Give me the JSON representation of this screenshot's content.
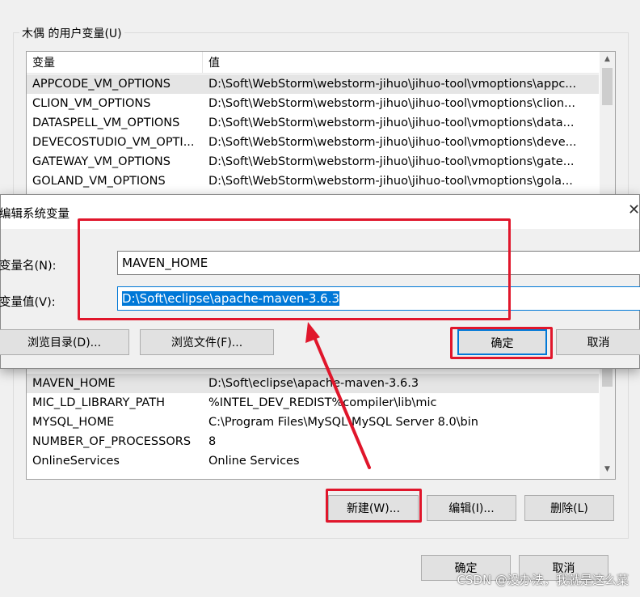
{
  "user_vars": {
    "group_title": "木偶 的用户变量(U)",
    "header": {
      "name": "变量",
      "value": "值"
    },
    "rows_top": [
      {
        "name": "APPCODE_VM_OPTIONS",
        "value": "D:\\Soft\\WebStorm\\webstorm-jihuo\\jihuo-tool\\vmoptions\\appc..."
      },
      {
        "name": "CLION_VM_OPTIONS",
        "value": "D:\\Soft\\WebStorm\\webstorm-jihuo\\jihuo-tool\\vmoptions\\clion..."
      },
      {
        "name": "DATASPELL_VM_OPTIONS",
        "value": "D:\\Soft\\WebStorm\\webstorm-jihuo\\jihuo-tool\\vmoptions\\data..."
      },
      {
        "name": "DEVECOSTUDIO_VM_OPTI...",
        "value": "D:\\Soft\\WebStorm\\webstorm-jihuo\\jihuo-tool\\vmoptions\\deve..."
      },
      {
        "name": "GATEWAY_VM_OPTIONS",
        "value": "D:\\Soft\\WebStorm\\webstorm-jihuo\\jihuo-tool\\vmoptions\\gate..."
      },
      {
        "name": "GOLAND_VM_OPTIONS",
        "value": "D:\\Soft\\WebStorm\\webstorm-jihuo\\jihuo-tool\\vmoptions\\gola..."
      }
    ],
    "rows_bottom": [
      {
        "name": "MAVEN_HOME",
        "value": "D:\\Soft\\eclipse\\apache-maven-3.6.3"
      },
      {
        "name": "MIC_LD_LIBRARY_PATH",
        "value": "%INTEL_DEV_REDIST%compiler\\lib\\mic"
      },
      {
        "name": "MYSQL_HOME",
        "value": "C:\\Program Files\\MySQL\\MySQL Server 8.0\\bin"
      },
      {
        "name": "NUMBER_OF_PROCESSORS",
        "value": "8"
      },
      {
        "name": "OnlineServices",
        "value": "Online Services"
      }
    ],
    "buttons": {
      "new": "新建(W)...",
      "edit": "编辑(I)...",
      "delete": "删除(L)"
    }
  },
  "bottom_buttons": {
    "ok": "确定",
    "cancel": "取消"
  },
  "dialog": {
    "title": "编辑系统变量",
    "close_icon": "close-icon",
    "name_label": "变量名(N):",
    "name_value": "MAVEN_HOME",
    "value_label": "变量值(V):",
    "value_value": "D:\\Soft\\eclipse\\apache-maven-3.6.3",
    "browse_dir": "浏览目录(D)...",
    "browse_file": "浏览文件(F)...",
    "ok": "确定",
    "cancel": "取消"
  },
  "annotation_color": "#e0162b",
  "watermark": "CSDN @没办法，我就是这么菜"
}
